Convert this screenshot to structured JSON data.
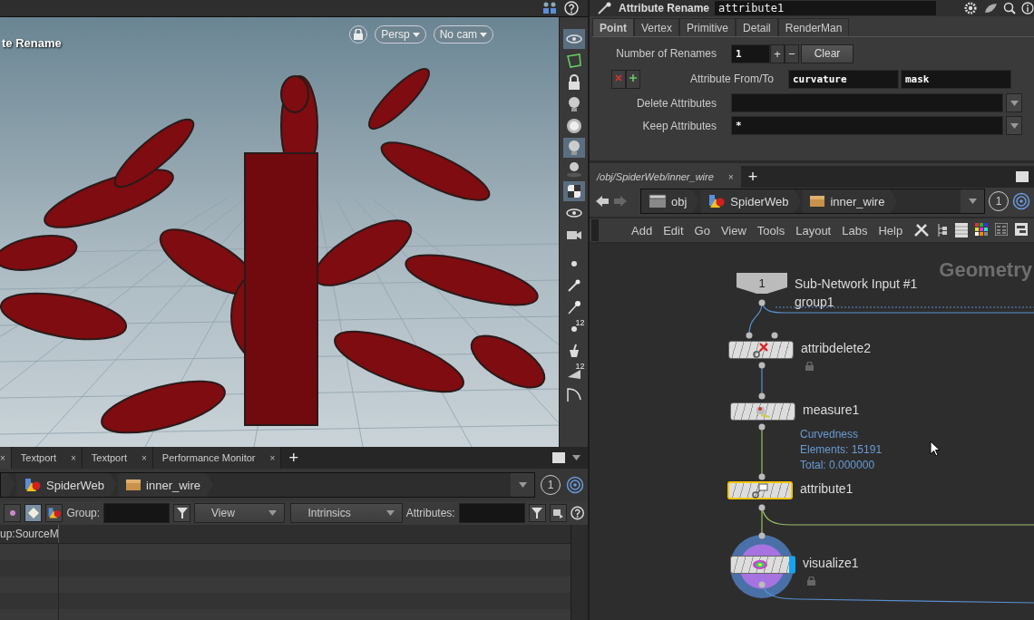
{
  "viewport": {
    "title": "te Rename",
    "camera_menus": [
      {
        "label": "Persp"
      },
      {
        "label": "No cam"
      }
    ],
    "toolbar": [
      {
        "selected": true
      },
      {
        "selected": false
      },
      {
        "selected": false
      },
      {
        "selected": false
      },
      {
        "selected": false
      },
      {
        "selected": true
      },
      {
        "selected": false
      },
      {
        "selected": true
      },
      {
        "selected": false
      },
      {
        "selected": false
      },
      {
        "selected": false
      },
      {
        "selected": false
      },
      {
        "selected": false
      },
      {
        "selected": false,
        "label": "12"
      },
      {
        "selected": false
      },
      {
        "selected": false,
        "label": "12"
      },
      {
        "selected": false
      }
    ]
  },
  "bottom_pane": {
    "tabs": [
      {
        "close": "×",
        "selected": true
      },
      {
        "label": "Textport",
        "close": "×",
        "selected": false
      },
      {
        "label": "Textport",
        "close": "×",
        "selected": false
      },
      {
        "label": "Performance Monitor",
        "close": "×",
        "selected": false
      }
    ],
    "add_tab": "+",
    "path": [
      "SpiderWeb",
      "inner_wire"
    ],
    "pin_label": "1",
    "toolbar": {
      "group_label": "Group:",
      "view_menu": "View",
      "intrinsics_menu": "Intrinsics",
      "attributes_label": "Attributes:"
    },
    "table": {
      "columns": [
        "up:SourceM"
      ]
    }
  },
  "parameters": {
    "node_type": "Attribute Rename",
    "node_name": "attribute1",
    "tabs": [
      {
        "label": "Point",
        "selected": true
      },
      {
        "label": "Vertex",
        "selected": false
      },
      {
        "label": "Primitive",
        "selected": false
      },
      {
        "label": "Detail",
        "selected": false
      },
      {
        "label": "RenderMan",
        "selected": false
      }
    ],
    "number_of_renames": {
      "label": "Number of Renames",
      "value": "1",
      "add": "+",
      "remove": "−",
      "clear": "Clear"
    },
    "rename": {
      "label": "Attribute From/To",
      "from": "curvature",
      "to": "mask"
    },
    "delete_attributes": {
      "label": "Delete Attributes"
    },
    "keep_attributes": {
      "label": "Keep Attributes",
      "value": "*"
    }
  },
  "network": {
    "tab": {
      "label": "/obj/SpiderWeb/inner_wire",
      "close": "×",
      "selected": true
    },
    "add_tab": "+",
    "path": [
      "obj",
      "SpiderWeb",
      "inner_wire"
    ],
    "pin_label": "1",
    "menu": [
      "Add",
      "Edit",
      "Go",
      "View",
      "Tools",
      "Layout",
      "Labs",
      "Help"
    ],
    "context_label": "Geometry",
    "nodes": [
      {
        "kind": "input",
        "badge": "1",
        "name": "Sub-Network Input #1",
        "subtitle": "group1",
        "selected": false
      },
      {
        "kind": "sop",
        "name": "attribdelete2",
        "selected": false,
        "locked": true,
        "display": false
      },
      {
        "kind": "sop",
        "name": "measure1",
        "info": [
          "Curvedness",
          "Elements: 15191",
          "Total: 0.000000"
        ],
        "selected": false,
        "locked": false,
        "display": false
      },
      {
        "kind": "sop",
        "name": "attribute1",
        "selected": true,
        "locked": false,
        "display": false
      },
      {
        "kind": "visualize",
        "name": "visualize1",
        "selected": false,
        "locked": true,
        "display": true
      }
    ]
  }
}
